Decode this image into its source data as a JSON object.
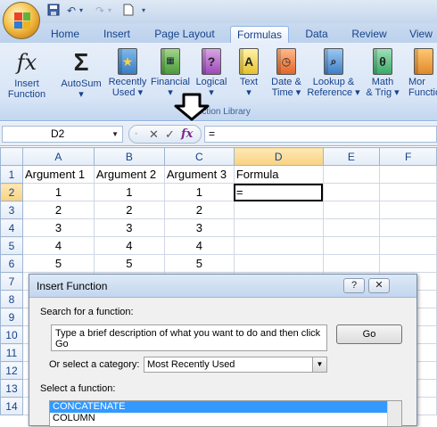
{
  "qat": {
    "undo": "↶",
    "redo": "↷",
    "more": "▾"
  },
  "tabs": [
    "Home",
    "Insert",
    "Page Layout",
    "Formulas",
    "Data",
    "Review",
    "View"
  ],
  "ribbon": {
    "insert_function": {
      "icon": "fx",
      "line1": "Insert",
      "line2": "Function"
    },
    "autosum": {
      "icon": "Σ",
      "line1": "AutoSum",
      "line2": "▾"
    },
    "recently_used": {
      "line1": "Recently",
      "line2": "Used ▾"
    },
    "financial": {
      "line1": "Financial",
      "line2": "▾"
    },
    "logical": {
      "icon": "?",
      "line1": "Logical",
      "line2": "▾"
    },
    "text": {
      "icon": "A",
      "line1": "Text",
      "line2": "▾"
    },
    "date_time": {
      "line1": "Date &",
      "line2": "Time ▾"
    },
    "lookup_reference": {
      "line1": "Lookup &",
      "line2": "Reference ▾"
    },
    "math_trig": {
      "icon": "θ",
      "line1": "Math",
      "line2": "& Trig ▾"
    },
    "more_functions": {
      "line1": "Mor",
      "line2": "Functio"
    },
    "group_label": "Function Library"
  },
  "formula_bar": {
    "name_box": "D2",
    "cancel": "✕",
    "enter": "✓",
    "fx": "fx",
    "content": "="
  },
  "sheet": {
    "columns": [
      "A",
      "B",
      "C",
      "D",
      "E",
      "F"
    ],
    "rows": [
      "1",
      "2",
      "3",
      "4",
      "5",
      "6",
      "7",
      "8",
      "9",
      "10",
      "11",
      "12",
      "13",
      "14"
    ],
    "cells": [
      [
        "Argument 1",
        "Argument 2",
        "Argument 3",
        "Formula",
        "",
        ""
      ],
      [
        "1",
        "1",
        "1",
        "=",
        "",
        ""
      ],
      [
        "2",
        "2",
        "2",
        "",
        "",
        ""
      ],
      [
        "3",
        "3",
        "3",
        "",
        "",
        ""
      ],
      [
        "4",
        "4",
        "4",
        "",
        "",
        ""
      ],
      [
        "5",
        "5",
        "5",
        "",
        "",
        ""
      ]
    ]
  },
  "dialog": {
    "title": "Insert Function",
    "help": "?",
    "close": "✕",
    "search_label": "Search for a function:",
    "search_text": "Type a brief description of what you want to do and then click Go",
    "go_label": "Go",
    "category_label": "Or select a category:",
    "category_value": "Most Recently Used",
    "select_label": "Select a function:",
    "functions": [
      "CONCATENATE",
      "COLUMN"
    ]
  },
  "colors": {
    "ribbon_blue": "#15428b",
    "selection": "#3399ff",
    "header_selected": "#f9d27e"
  }
}
